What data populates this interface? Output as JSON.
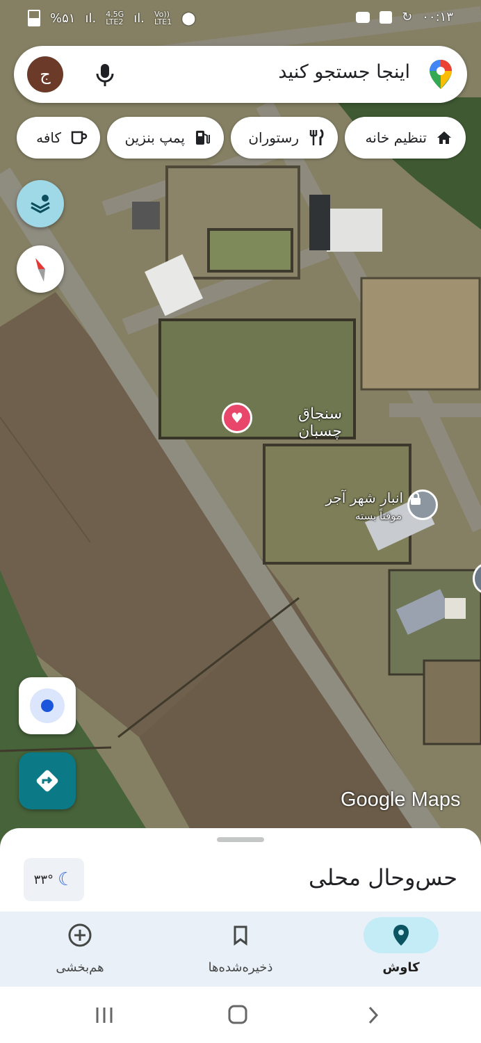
{
  "status_bar": {
    "time": "۰۰:۱۳",
    "battery": "%۵۱",
    "net1_top": "4.5G",
    "net1_bottom": "LTE2",
    "net2_top": "Vo))",
    "net2_bottom": "LTE1"
  },
  "search": {
    "placeholder": "اینجا جستجو کنید",
    "avatar_letter": "ج",
    "mic_icon": "mic-icon",
    "logo_icon": "google-maps-pin-icon"
  },
  "chips": [
    {
      "label": "تنظیم خانه",
      "icon": "home-icon"
    },
    {
      "label": "رستوران",
      "icon": "fork-knife-icon"
    },
    {
      "label": "پمپ بنزین",
      "icon": "gas-pump-icon"
    },
    {
      "label": "کافه",
      "icon": "coffee-icon"
    }
  ],
  "map": {
    "place_saved": "سنجاق چسبان",
    "place_poi_name": "انبار شهر آجر",
    "place_poi_status": "موقتاً بسته",
    "watermark": "Google Maps"
  },
  "bottom_sheet": {
    "title": "حس‌وحال محلی",
    "temperature": "۳۳°",
    "weather_icon": "moon-icon"
  },
  "bottom_nav": [
    {
      "label": "کاوش",
      "icon": "location-pin-icon",
      "active": true
    },
    {
      "label": "ذخیره‌شده‌ها",
      "icon": "bookmark-icon",
      "active": false
    },
    {
      "label": "هم‌بخشی",
      "icon": "add-circle-icon",
      "active": false
    }
  ],
  "colors": {
    "accent": "#c3ecf6",
    "layers_button": "#9fd9e8",
    "directions_button": "#0b7a86",
    "saved_pin": "#e8466a"
  }
}
